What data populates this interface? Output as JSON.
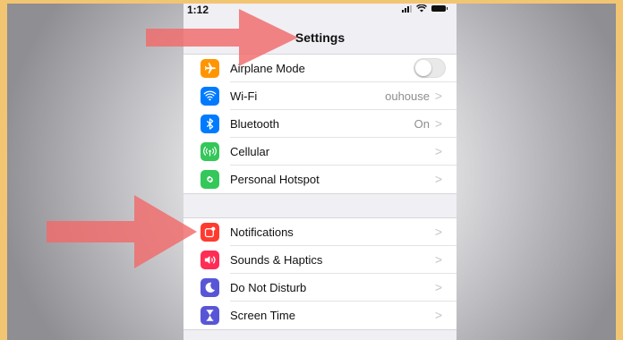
{
  "status_bar": {
    "time": "1:12"
  },
  "nav": {
    "title": "Settings"
  },
  "colors": {
    "airplane": "#ff9500",
    "wifi": "#007aff",
    "bluetooth": "#007aff",
    "cellular": "#34c759",
    "hotspot": "#34c759",
    "notifications": "#ff3b30",
    "sounds": "#ff2d55",
    "dnd": "#5856d6",
    "screen_time": "#5856d6",
    "annotation_arrow": "#f26b6b"
  },
  "group1": [
    {
      "label": "Airplane Mode",
      "icon": "airplane-icon",
      "control": "toggle",
      "toggle_on": false
    },
    {
      "label": "Wi-Fi",
      "icon": "wifi-icon",
      "value": "ouhouse",
      "chevron": ">"
    },
    {
      "label": "Bluetooth",
      "icon": "bluetooth-icon",
      "value": "On",
      "chevron": ">"
    },
    {
      "label": "Cellular",
      "icon": "cellular-icon",
      "chevron": ">"
    },
    {
      "label": "Personal Hotspot",
      "icon": "hotspot-icon",
      "chevron": ">"
    }
  ],
  "group2": [
    {
      "label": "Notifications",
      "icon": "notifications-icon",
      "chevron": ">"
    },
    {
      "label": "Sounds & Haptics",
      "icon": "sounds-icon",
      "chevron": ">"
    },
    {
      "label": "Do Not Disturb",
      "icon": "moon-icon",
      "chevron": ">"
    },
    {
      "label": "Screen Time",
      "icon": "hourglass-icon",
      "chevron": ">"
    }
  ]
}
